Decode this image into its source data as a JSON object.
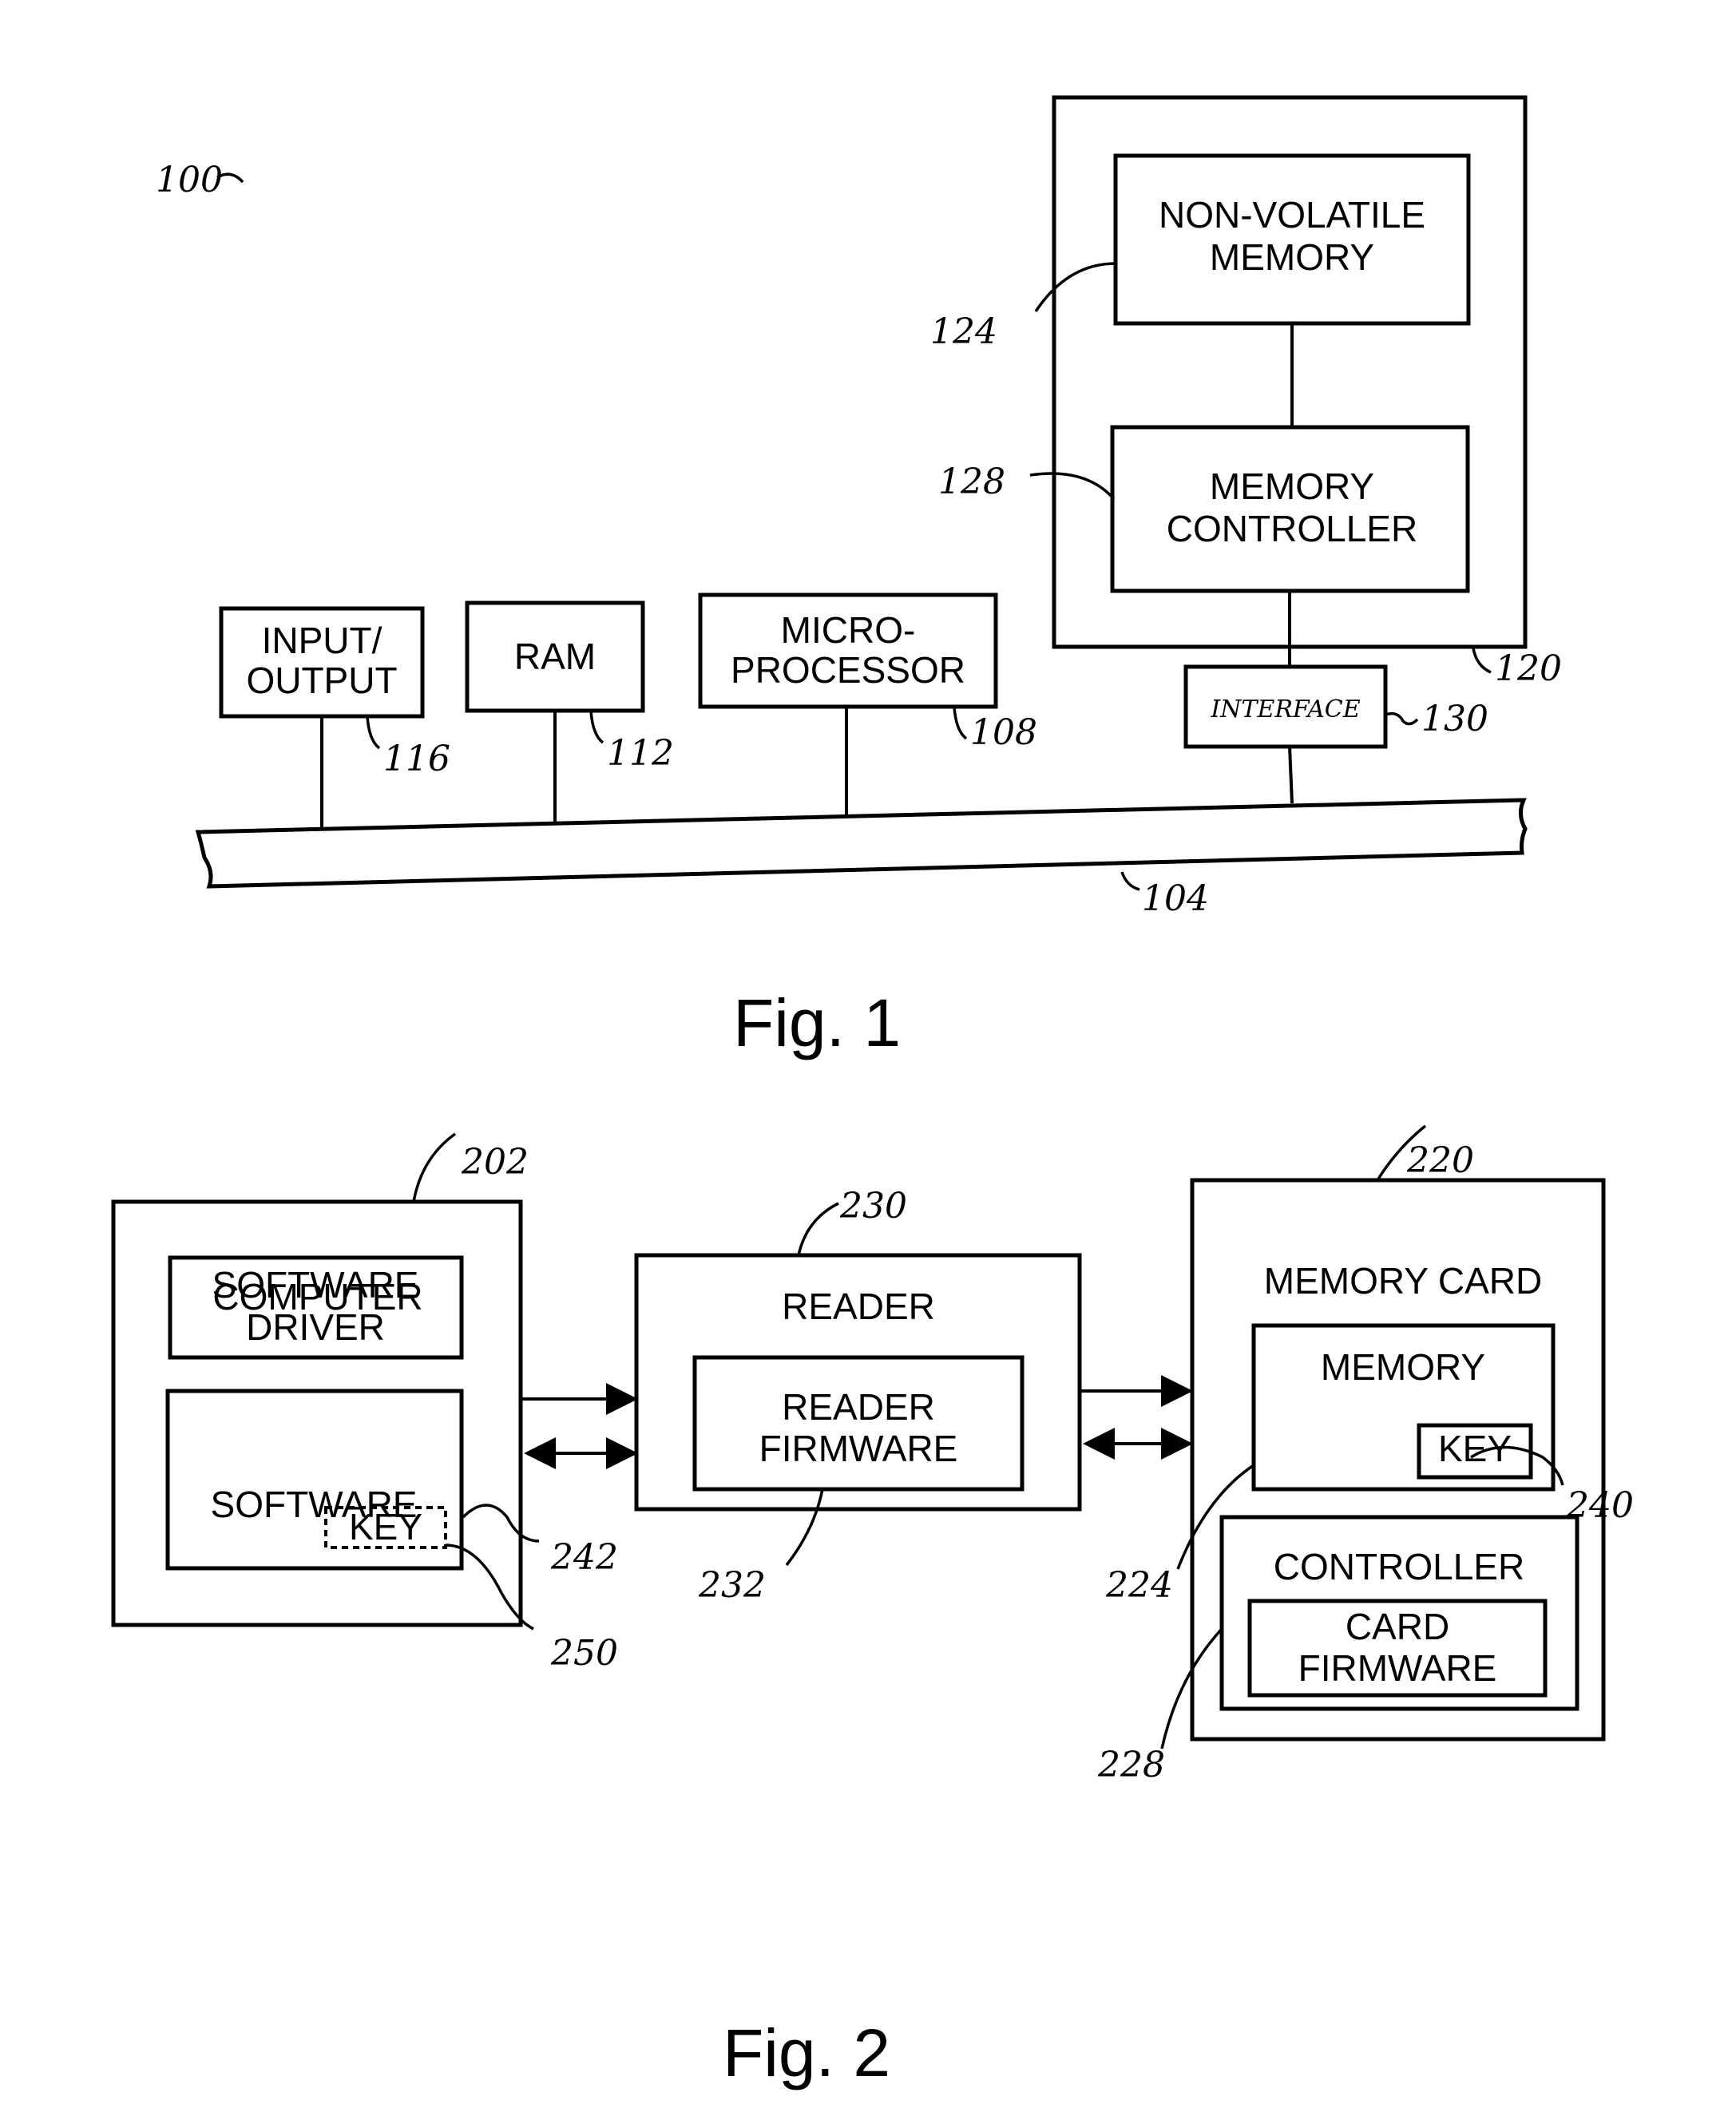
{
  "figure1": {
    "caption": "Fig. 1",
    "system_ref": "100",
    "bus": {
      "ref": "104"
    },
    "blocks": {
      "io": {
        "lines": [
          "INPUT/",
          "OUTPUT"
        ],
        "ref": "116"
      },
      "ram": {
        "lines": [
          "RAM"
        ],
        "ref": "112"
      },
      "cpu": {
        "lines": [
          "MICRO-",
          "PROCESSOR"
        ],
        "ref": "108"
      },
      "storage_device": {
        "ref": "120"
      },
      "nvm": {
        "lines": [
          "NON-VOLATILE",
          "MEMORY"
        ],
        "ref": "124"
      },
      "mem_ctrl": {
        "lines": [
          "MEMORY",
          "CONTROLLER"
        ],
        "ref": "128"
      },
      "interface": {
        "lines": [
          "INTERFACE"
        ],
        "ref": "130"
      }
    }
  },
  "figure2": {
    "caption": "Fig. 2",
    "computer": {
      "title": "COMPUTER",
      "ref": "202",
      "driver": {
        "lines": [
          "SOFTWARE",
          "DRIVER"
        ]
      },
      "software": {
        "title": "SOFTWARE",
        "ref": "242",
        "key": {
          "label": "KEY",
          "ref": "250"
        }
      }
    },
    "reader": {
      "title": "READER",
      "ref": "230",
      "firmware": {
        "lines": [
          "READER",
          "FIRMWARE"
        ],
        "ref": "232"
      }
    },
    "memory_card": {
      "title": "MEMORY CARD",
      "ref": "220",
      "memory": {
        "title": "MEMORY",
        "ref": "224",
        "key": {
          "label": "KEY",
          "ref": "240"
        }
      },
      "controller": {
        "title": "CONTROLLER",
        "ref": "228",
        "firmware": {
          "lines": [
            "CARD",
            "FIRMWARE"
          ]
        }
      }
    }
  }
}
